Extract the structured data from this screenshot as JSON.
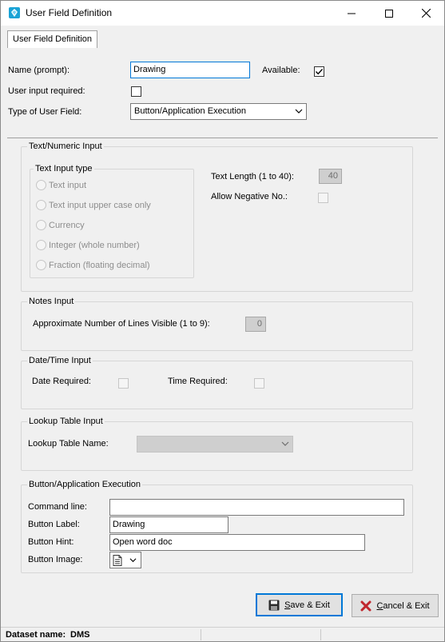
{
  "window": {
    "title": "User Field Definition"
  },
  "tab": {
    "label": "User Field Definition"
  },
  "form": {
    "name_label": "Name (prompt):",
    "name_value": "Drawing",
    "available_label": "Available:",
    "available_checked": true,
    "required_label": "User input required:",
    "required_checked": false,
    "type_label": "Type of User Field:",
    "type_value": "Button/Application Execution"
  },
  "text_numeric": {
    "title": "Text/Numeric Input",
    "text_input_type_title": "Text Input type",
    "options": [
      "Text input",
      "Text input upper case only",
      "Currency",
      "Integer (whole number)",
      "Fraction (floating decimal)"
    ],
    "text_length_label": "Text Length (1 to 40):",
    "text_length_value": "40",
    "allow_negative_label": "Allow Negative No.:"
  },
  "notes": {
    "title": "Notes Input",
    "lines_label": "Approximate Number of Lines Visible (1 to 9):",
    "lines_value": "0"
  },
  "datetime": {
    "title": "Date/Time Input",
    "date_label": "Date Required:",
    "time_label": "Time Required:"
  },
  "lookup": {
    "title": "Lookup Table Input",
    "name_label": "Lookup Table Name:",
    "name_value": ""
  },
  "button_exec": {
    "title": "Button/Application Execution",
    "command_label": "Command line:",
    "command_value": "",
    "button_label_label": "Button Label:",
    "button_label_value": "Drawing",
    "hint_label": "Button Hint:",
    "hint_value": "Open word doc",
    "image_label": "Button Image:",
    "image_icon": "document-icon"
  },
  "buttons": {
    "save_mnemonic": "S",
    "save_rest": "ave & Exit",
    "cancel_mnemonic": "C",
    "cancel_rest": "ancel & Exit"
  },
  "status": {
    "dataset_label": "Dataset name:",
    "dataset_value": "DMS"
  },
  "colors": {
    "accent": "#0078d7",
    "cancel_icon": "#c0262d",
    "app_icon": "#1aa3d6"
  }
}
